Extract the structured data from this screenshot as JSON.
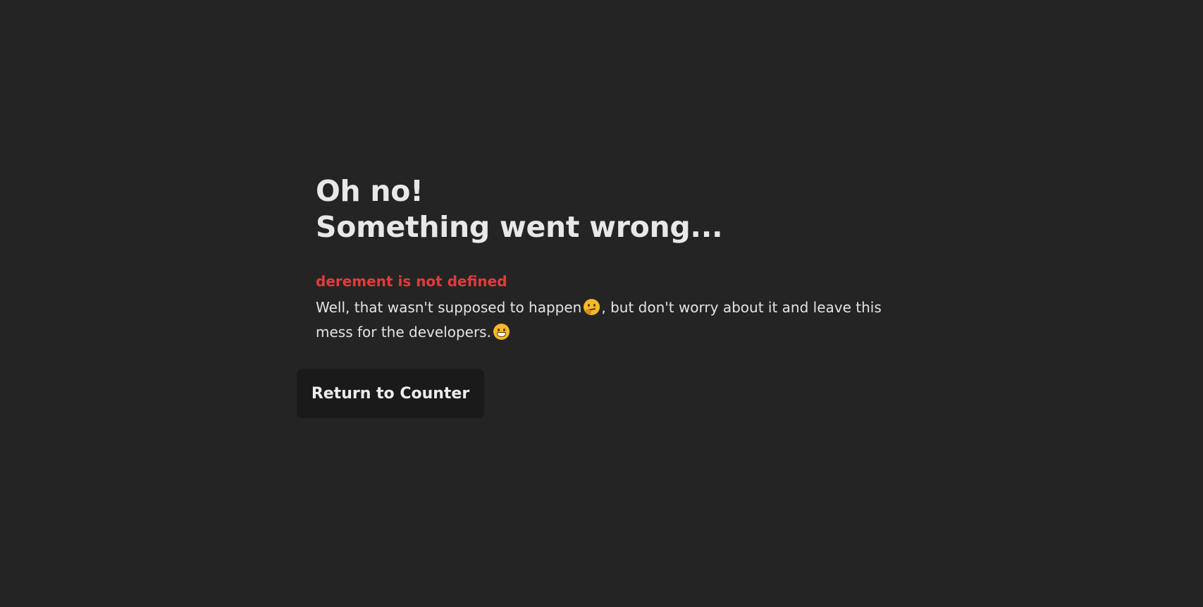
{
  "error_page": {
    "title_line1": "Oh no!",
    "title_line2": "Something went wrong...",
    "error_message": "derement is not defined",
    "description_part1": "Well, that wasn't supposed to happen",
    "emoji1": "thinking-face-emoji",
    "description_part2": ", but don't worry about it and leave this mess for the developers.",
    "emoji2": "grinning-face-emoji",
    "return_button_label": "Return to Counter"
  },
  "colors": {
    "background": "#242424",
    "text": "#e6e6e6",
    "error": "#e03c3c",
    "button_background": "#1a1a1a"
  }
}
